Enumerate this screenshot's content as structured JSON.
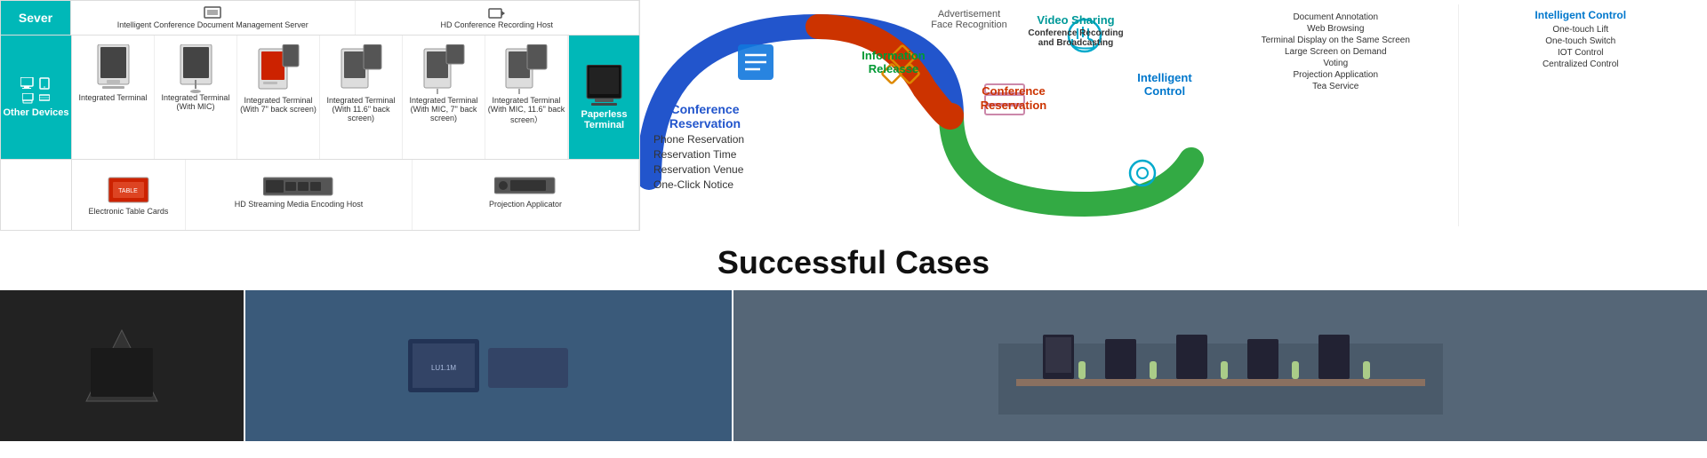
{
  "server": {
    "label": "Sever",
    "items": [
      {
        "name": "Intelligent Conference Document Management Server"
      },
      {
        "name": "HD Conference Recording Host"
      }
    ]
  },
  "devices": {
    "other_devices_label": "Other Devices",
    "paperless_terminal_label": "Paperless Terminal",
    "items": [
      {
        "name": "Integrated Terminal"
      },
      {
        "name": "Integrated Terminal (With MIC)"
      },
      {
        "name": "Integrated Terminal (With 7\" back screen)"
      },
      {
        "name": "Integrated Terminal (With 11.6\" back screen)"
      },
      {
        "name": "Integrated Terminal (With MIC, 7\" back screen)"
      },
      {
        "name": "Integrated Terminal (With MIC, 11.6\" back screen）"
      }
    ],
    "other_items": [
      {
        "name": "Electronic Table Cards"
      },
      {
        "name": "HD Streaming Media Encoding Host"
      },
      {
        "name": "Projection Applicator"
      }
    ]
  },
  "diagram": {
    "title": "Conference Reservation",
    "sections": [
      {
        "label": "Conference Reservation",
        "color": "#2255cc",
        "items": [
          "Phone Reservation",
          "Reservation Time",
          "Reservation Venue",
          "One-Click Notice"
        ]
      },
      {
        "label": "Information Releasse",
        "color": "#009933",
        "items": []
      }
    ]
  },
  "features_top": {
    "advertisement": "Advertisement",
    "face_recognition": "Face Recognition",
    "video_sharing": "Video Sharing",
    "conf_recording": "Conference Recording and Broadcasting"
  },
  "conference_reservation_panel": {
    "title": "Conference Reservation",
    "items": [
      "Phone Reservation",
      "Reservation Time",
      "Reservation Venue",
      "One-Click Notice"
    ]
  },
  "conference_reservation_right": {
    "title": "Conference Reservation",
    "items": [
      "Document Annotation",
      "Web Browsing",
      "Terminal Display on the Same Screen",
      "Large Screen on Demand",
      "Voting",
      "Projection Application",
      "Tea Service"
    ]
  },
  "intelligent_control": {
    "title": "Intelligent Control",
    "items": [
      "One-touch Lift",
      "One-touch Switch",
      "IOT Control",
      "Centralized Control"
    ]
  },
  "successful_cases": {
    "title": "Successful Cases"
  }
}
